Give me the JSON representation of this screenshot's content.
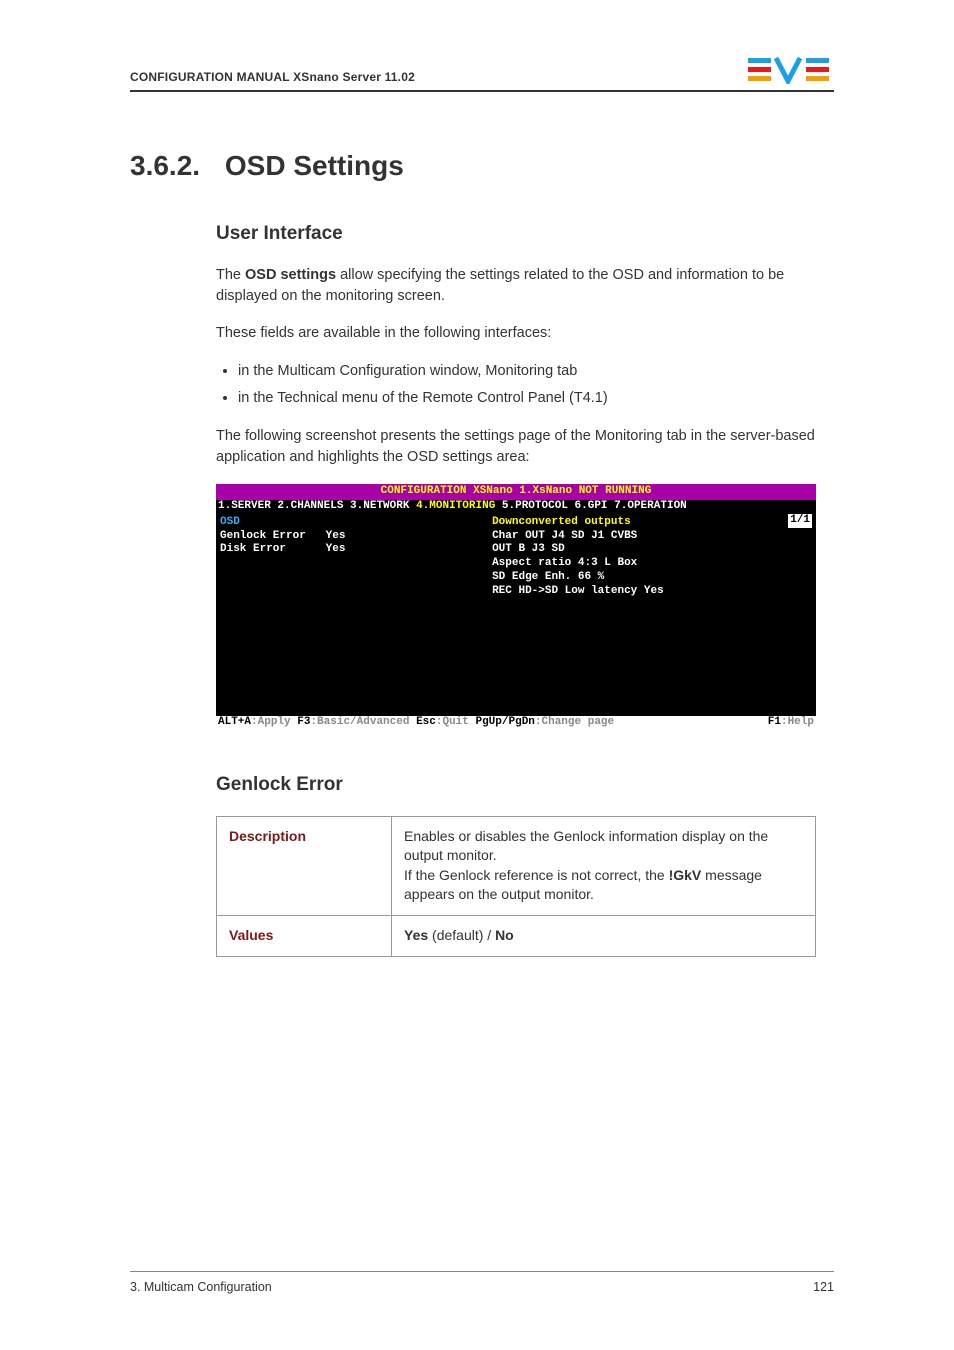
{
  "header": {
    "manual": "CONFIGURATION MANUAL",
    "product": "XSnano Server 11.02"
  },
  "section": {
    "number": "3.6.2.",
    "title": "OSD Settings"
  },
  "ui": {
    "heading": "User Interface",
    "p1a": "The ",
    "p1b": "OSD settings",
    "p1c": " allow specifying the settings related to the OSD and information to be displayed on the monitoring screen.",
    "p2": "These fields are available in the following interfaces:",
    "b1": "in the Multicam Configuration window, Monitoring tab",
    "b2": "in the Technical menu of the Remote Control Panel (T4.1)",
    "p3": "The following screenshot presents the settings page of the Monitoring tab in the server-based application and highlights the OSD settings area:"
  },
  "screenshot": {
    "title": "CONFIGURATION XSNano 1.XsNano NOT RUNNING",
    "tabs": {
      "t1": "1.SERVER",
      "t2": "2.CHANNELS",
      "t3": "3.NETWORK",
      "t4": "4.MONITORING",
      "t5": "5.PROTOCOL",
      "t6": "6.GPI",
      "t7": "7.OPERATION"
    },
    "pager": "1/1",
    "osd": {
      "hdr": "OSD",
      "r1k": "Genlock Error",
      "r1v": "Yes",
      "r2k": "Disk Error",
      "r2v": "Yes"
    },
    "right": {
      "hdr": "Downconverted outputs",
      "l1": "Char OUT J4 SD     J1 CVBS",
      "l2": "OUT B J3 SD",
      "l3": "Aspect ratio 4:3 L Box",
      "l4": "SD Edge Enh. 66 %",
      "l5": "REC HD->SD Low latency Yes"
    },
    "footer": {
      "f1a": "ALT+A",
      "f1b": ":Apply ",
      "f2a": "F3",
      "f2b": ":Basic/Advanced ",
      "f3a": "Esc",
      "f3b": ":Quit ",
      "f4a": "PgUp/PgDn",
      "f4b": ":Change page",
      "f5a": "F1",
      "f5b": ":Help"
    }
  },
  "genlock": {
    "heading": "Genlock Error",
    "desc_k": "Description",
    "desc_v1": "Enables or disables the Genlock information display on the output monitor.",
    "desc_v2a": "If the Genlock reference is not correct, the ",
    "desc_v2b": "!GkV",
    "desc_v2c": " message appears on the output monitor.",
    "val_k": "Values",
    "val_a": "Yes",
    "val_b": " (default) / ",
    "val_c": "No"
  },
  "footer": {
    "left": "3. Multicam Configuration",
    "right": "121"
  }
}
